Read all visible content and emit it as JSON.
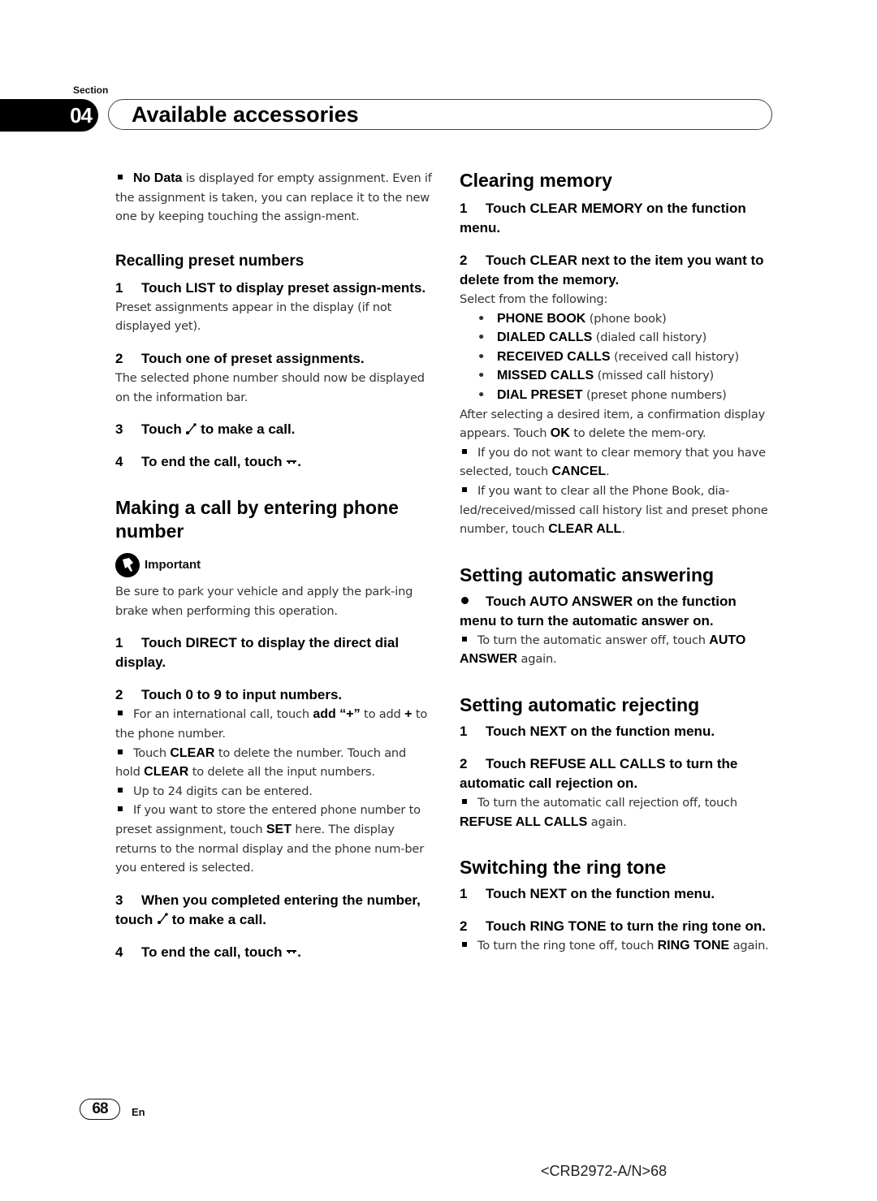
{
  "header": {
    "section_label": "Section",
    "section_number": "04",
    "section_title": "Available accessories"
  },
  "left": {
    "intro_bullet_bold": "No Data",
    "intro_bullet_text": " is displayed for empty assignment. Even if the assignment is taken, you can replace it to the new one by keeping touching the assign-ment.",
    "recall": {
      "heading": "Recalling preset numbers",
      "steps": [
        {
          "num": "1",
          "text": "Touch LIST to display preset assign-ments.",
          "desc": "Preset assignments appear in the display (if not displayed yet)."
        },
        {
          "num": "2",
          "text": "Touch one of preset assignments.",
          "desc": "The selected phone number should now be displayed on the information bar."
        },
        {
          "num": "3",
          "pre": "Touch ",
          "post": " to make a call.",
          "icon": "phone-call-icon"
        },
        {
          "num": "4",
          "pre": "To end the call, touch ",
          "post": ".",
          "icon": "phone-hangup-icon"
        }
      ]
    },
    "direct": {
      "heading": "Making a call by entering phone number",
      "important_label": "Important",
      "important_text": "Be sure to park your vehicle and apply the park-ing brake when performing this operation.",
      "step1": {
        "num": "1",
        "text": "Touch DIRECT to display the direct dial display."
      },
      "step2": {
        "num": "2",
        "text": "Touch 0 to 9 to input numbers."
      },
      "notes": [
        {
          "pre": "For an international call, touch ",
          "bold": "add “+”",
          "mid": " to add ",
          "bold2": "+",
          "post": " to the phone number."
        },
        {
          "pre": "Touch ",
          "bold": "CLEAR",
          "mid": " to delete the number. Touch and hold ",
          "bold2": "CLEAR",
          "post": " to delete all the input numbers."
        },
        {
          "pre": "Up to 24 digits can be entered.",
          "bold": "",
          "mid": "",
          "bold2": "",
          "post": ""
        },
        {
          "pre": "If you want to store the entered phone number to preset assignment, touch ",
          "bold": "SET",
          "mid": " here. The display returns to the normal display and the phone num-ber you entered is selected.",
          "bold2": "",
          "post": ""
        }
      ],
      "step3": {
        "num": "3",
        "pre": "When you completed entering the number, touch ",
        "post": " to make a call."
      },
      "step4": {
        "num": "4",
        "pre": "To end the call, touch ",
        "post": "."
      }
    }
  },
  "right": {
    "clearing": {
      "heading": "Clearing memory",
      "step1": {
        "num": "1",
        "text": "Touch CLEAR MEMORY on the function menu."
      },
      "step2": {
        "num": "2",
        "text": "Touch CLEAR next to the item you want to delete from the memory."
      },
      "select_text": "Select from the following:",
      "items": [
        {
          "bold": "PHONE BOOK",
          "desc": " (phone book)"
        },
        {
          "bold": "DIALED CALLS",
          "desc": " (dialed call history)"
        },
        {
          "bold": "RECEIVED CALLS",
          "desc": " (received call history)"
        },
        {
          "bold": "MISSED CALLS",
          "desc": " (missed call history)"
        },
        {
          "bold": "DIAL PRESET",
          "desc": " (preset phone numbers)"
        }
      ],
      "after_pre": "After selecting a desired item, a confirmation display appears. Touch ",
      "after_bold": "OK",
      "after_post": " to delete the mem-ory.",
      "notes": [
        {
          "pre": "If you do not want to clear memory that you have selected, touch ",
          "bold": "CANCEL",
          "post": "."
        },
        {
          "pre": "If you want to clear all the Phone Book, dia-led/received/missed call history list and preset phone number, touch ",
          "bold": "CLEAR ALL",
          "post": "."
        }
      ]
    },
    "auto_answer": {
      "heading": "Setting automatic answering",
      "step": "Touch AUTO ANSWER on the function menu to turn the automatic answer on.",
      "note_pre": "To turn the automatic answer off, touch ",
      "note_bold": "AUTO ANSWER",
      "note_post": " again."
    },
    "auto_reject": {
      "heading": "Setting automatic rejecting",
      "step1": {
        "num": "1",
        "text": "Touch NEXT on the function menu."
      },
      "step2": {
        "num": "2",
        "text": "Touch REFUSE ALL CALLS to turn the automatic call rejection on."
      },
      "note_pre": "To turn the automatic call rejection off, touch ",
      "note_bold": "REFUSE ALL CALLS",
      "note_post": " again."
    },
    "ring_tone": {
      "heading": "Switching the ring tone",
      "step1": {
        "num": "1",
        "text": "Touch NEXT on the function menu."
      },
      "step2": {
        "num": "2",
        "text": "Touch RING TONE to turn the ring tone on."
      },
      "note_pre": "To turn the ring tone off, touch ",
      "note_bold": "RING TONE",
      "note_post": " again."
    }
  },
  "footer": {
    "page_number": "68",
    "language": "En",
    "doc_code": "<CRB2972-A/N>68"
  }
}
